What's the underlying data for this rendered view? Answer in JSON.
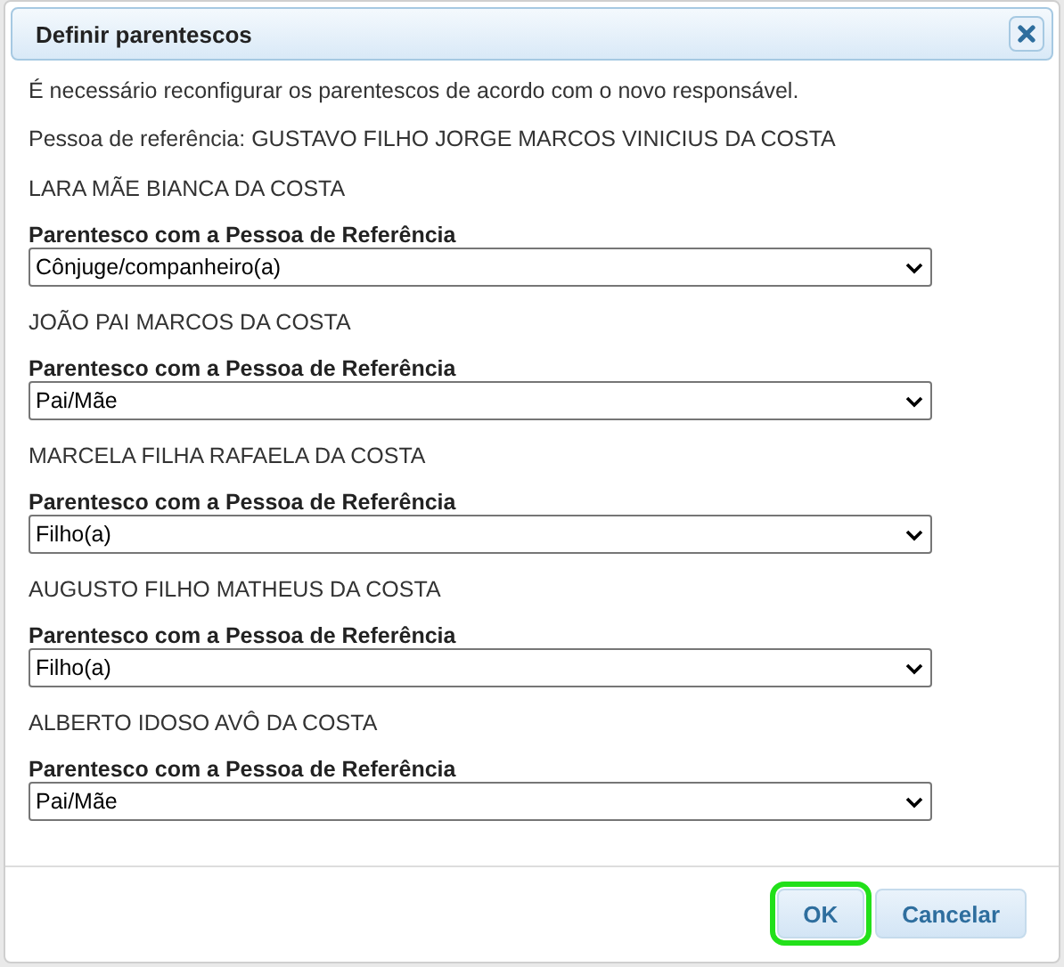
{
  "dialog": {
    "title": "Definir parentescos",
    "message": "É necessário reconfigurar os parentescos de acordo com o novo responsável.",
    "reference": "Pessoa de referência: GUSTAVO FILHO JORGE MARCOS VINICIUS DA COSTA",
    "members": [
      {
        "name": "LARA MÃE BIANCA DA COSTA",
        "label": "Parentesco com a Pessoa de Referência",
        "value": "Cônjuge/companheiro(a)"
      },
      {
        "name": "JOÃO PAI MARCOS DA COSTA",
        "label": "Parentesco com a Pessoa de Referência",
        "value": "Pai/Mãe"
      },
      {
        "name": "MARCELA FILHA RAFAELA DA COSTA",
        "label": "Parentesco com a Pessoa de Referência",
        "value": "Filho(a)"
      },
      {
        "name": "AUGUSTO FILHO MATHEUS DA COSTA",
        "label": "Parentesco com a Pessoa de Referência",
        "value": "Filho(a)"
      },
      {
        "name": "ALBERTO IDOSO AVÔ DA COSTA",
        "label": "Parentesco com a Pessoa de Referência",
        "value": "Pai/Mãe"
      }
    ],
    "buttons": [
      {
        "label": "OK",
        "focused": true
      },
      {
        "label": "Cancelar",
        "focused": false
      }
    ]
  }
}
